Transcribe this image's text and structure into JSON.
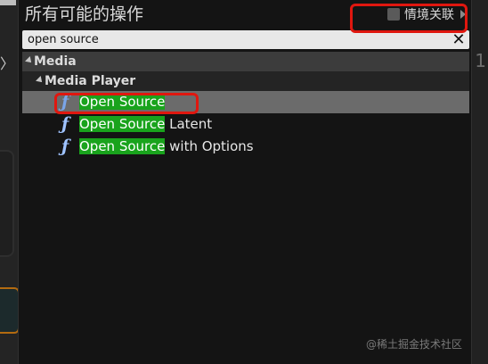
{
  "dialog": {
    "title": "所有可能的操作",
    "context_sensitive_label": "情境关联",
    "context_sensitive_checked": false
  },
  "search": {
    "value": "open source",
    "clear_label": "✕"
  },
  "tree": {
    "category": "Media",
    "subcategory": "Media Player",
    "items": [
      {
        "icon": "function-icon",
        "match": "Open Source",
        "suffix": "",
        "selected": true
      },
      {
        "icon": "function-icon",
        "match": "Open Source",
        "suffix": " Latent",
        "selected": false
      },
      {
        "icon": "function-icon",
        "match": "Open Source",
        "suffix": " with Options",
        "selected": false
      }
    ]
  },
  "background": {
    "right_label": "1",
    "left_arrow": "〉"
  },
  "watermark": "@稀土掘金技术社区",
  "colors": {
    "match_highlight": "#19a31c",
    "annotation_red": "#e0170f",
    "function_icon": "#9fc3ff"
  }
}
